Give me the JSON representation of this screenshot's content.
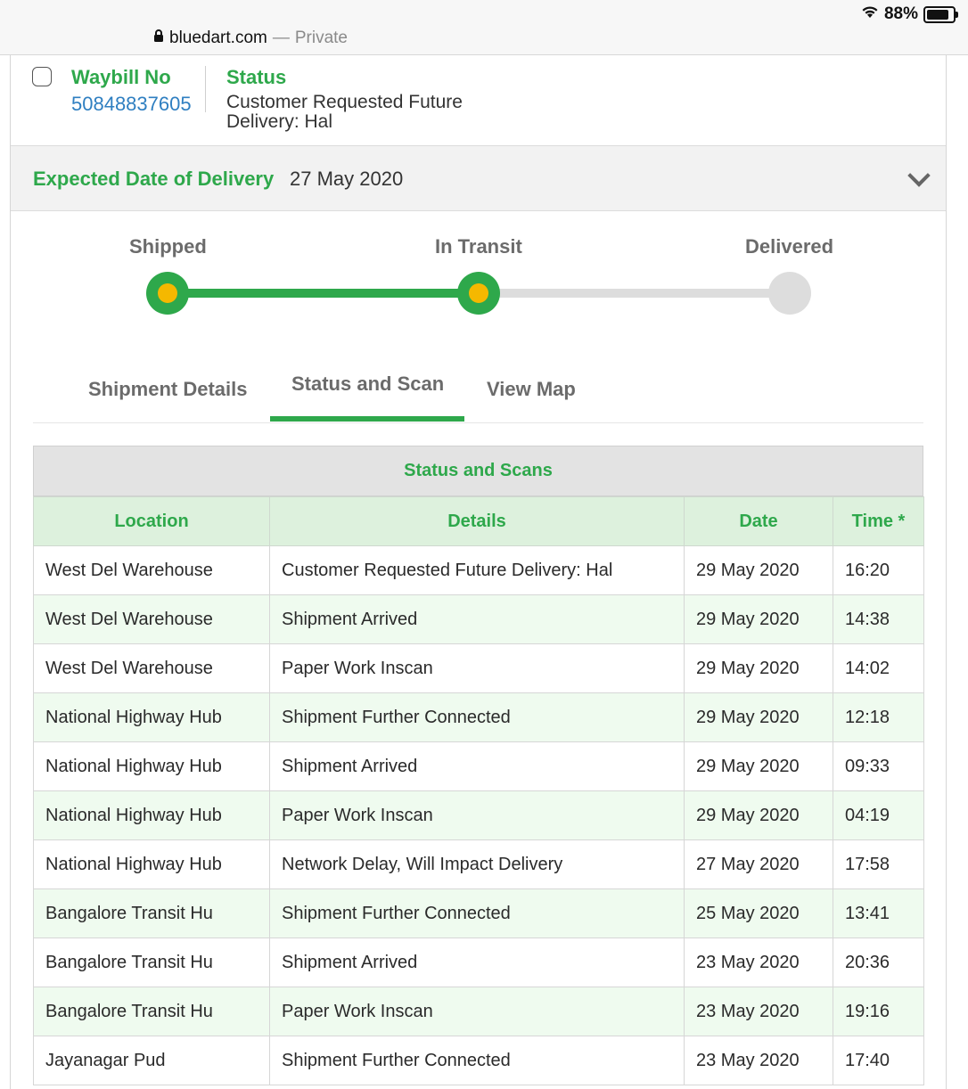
{
  "status_bar": {
    "battery": "88%"
  },
  "address_bar": {
    "domain": "bluedart.com",
    "separator": "—",
    "mode": "Private"
  },
  "shipment": {
    "waybill_label": "Waybill No",
    "waybill_number": "50848837605",
    "status_label": "Status",
    "status_value": "Customer Requested Future Delivery: Hal"
  },
  "expected_delivery": {
    "label": "Expected Date of Delivery",
    "date": "27 May 2020"
  },
  "progress": {
    "steps": [
      {
        "label": "Shipped",
        "state": "done"
      },
      {
        "label": "In Transit",
        "state": "done"
      },
      {
        "label": "Delivered",
        "state": "pending"
      }
    ],
    "completed_fraction": 0.5
  },
  "tabs": [
    {
      "label": "Shipment Details",
      "active": false
    },
    {
      "label": "Status and Scan",
      "active": true
    },
    {
      "label": "View Map",
      "active": false
    }
  ],
  "scans_table": {
    "title": "Status and Scans",
    "columns": [
      "Location",
      "Details",
      "Date",
      "Time *"
    ],
    "rows": [
      [
        "West Del Warehouse",
        "Customer Requested Future Delivery: Hal",
        "29 May 2020",
        "16:20"
      ],
      [
        "West Del Warehouse",
        "Shipment Arrived",
        "29 May 2020",
        "14:38"
      ],
      [
        "West Del Warehouse",
        "Paper Work Inscan",
        "29 May 2020",
        "14:02"
      ],
      [
        "National Highway Hub",
        "Shipment Further Connected",
        "29 May 2020",
        "12:18"
      ],
      [
        "National Highway Hub",
        "Shipment Arrived",
        "29 May 2020",
        "09:33"
      ],
      [
        "National Highway Hub",
        "Paper Work Inscan",
        "29 May 2020",
        "04:19"
      ],
      [
        "National Highway Hub",
        "Network Delay, Will Impact Delivery",
        "27 May 2020",
        "17:58"
      ],
      [
        "Bangalore Transit Hu",
        "Shipment Further Connected",
        "25 May 2020",
        "13:41"
      ],
      [
        "Bangalore Transit Hu",
        "Shipment Arrived",
        "23 May 2020",
        "20:36"
      ],
      [
        "Bangalore Transit Hu",
        "Paper Work Inscan",
        "23 May 2020",
        "19:16"
      ],
      [
        "Jayanagar Pud",
        "Shipment Further Connected",
        "23 May 2020",
        "17:40"
      ]
    ]
  },
  "colors": {
    "accent_green": "#2ea84b",
    "link_blue": "#2f7fc1",
    "progress_dot": "#f5b800",
    "row_alt": "#effbef",
    "header_bg": "#ddf1dd"
  }
}
